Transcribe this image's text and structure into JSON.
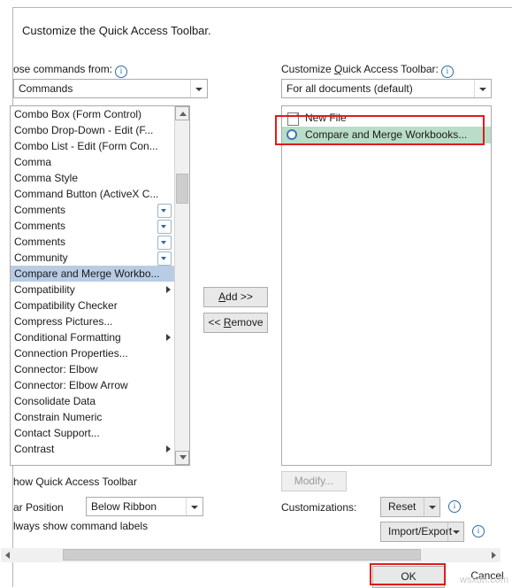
{
  "dialog": {
    "title": "Customize the Quick Access Toolbar.",
    "left_label": "ose commands from:",
    "left_combo_value": "Commands",
    "right_label": "Customize Quick Access Toolbar:",
    "right_label_underline": "Q",
    "right_combo_value": "For all documents (default)",
    "show_qat_label": "how Quick Access Toolbar",
    "bar_position_label": "ar Position",
    "bar_position_value": "Below Ribbon",
    "always_show_labels": "lways show command labels",
    "customizations_label": "Customizations:",
    "modify_label": "Modify...",
    "reset_label": "Reset",
    "import_export_label": "Import/Export",
    "add_label": "Add >>",
    "remove_label": "<< Remove",
    "ok_label": "OK",
    "cancel_label": "Cancel",
    "info_icon": "info-icon",
    "watermark": "wsxdn.com"
  },
  "command_list": [
    {
      "label": "Combo Box (Form Control)",
      "type": "plain"
    },
    {
      "label": "Combo Drop-Down - Edit (F...",
      "type": "plain"
    },
    {
      "label": "Combo List - Edit (Form Con...",
      "type": "plain"
    },
    {
      "label": "Comma",
      "type": "plain"
    },
    {
      "label": "Comma Style",
      "type": "plain"
    },
    {
      "label": "Command Button (ActiveX C...",
      "type": "plain"
    },
    {
      "label": "Comments",
      "type": "dropdown"
    },
    {
      "label": "Comments",
      "type": "dropdown"
    },
    {
      "label": "Comments",
      "type": "dropdown"
    },
    {
      "label": "Community",
      "type": "dropdown"
    },
    {
      "label": "Compare and Merge Workbo...",
      "type": "selected"
    },
    {
      "label": "Compatibility",
      "type": "submenu"
    },
    {
      "label": "Compatibility Checker",
      "type": "plain"
    },
    {
      "label": "Compress Pictures...",
      "type": "plain"
    },
    {
      "label": "Conditional Formatting",
      "type": "submenu"
    },
    {
      "label": "Connection Properties...",
      "type": "plain"
    },
    {
      "label": "Connector: Elbow",
      "type": "plain"
    },
    {
      "label": "Connector: Elbow Arrow",
      "type": "plain"
    },
    {
      "label": "Consolidate Data",
      "type": "plain"
    },
    {
      "label": "Constrain Numeric",
      "type": "plain"
    },
    {
      "label": "Contact Support...",
      "type": "plain"
    },
    {
      "label": "Contrast",
      "type": "submenu"
    }
  ],
  "qat_list": [
    {
      "label": "New File",
      "icon": "document-icon",
      "selected": false
    },
    {
      "label": "Compare and Merge Workbooks...",
      "icon": "circle-icon",
      "selected": true
    }
  ]
}
